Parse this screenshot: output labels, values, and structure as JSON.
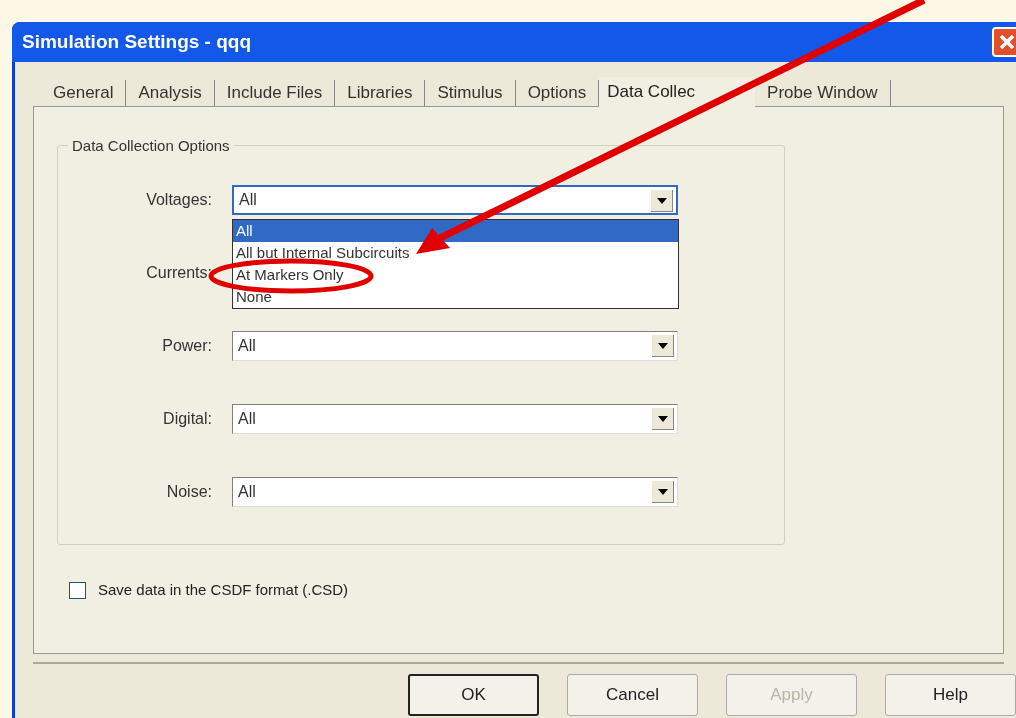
{
  "window": {
    "title": "Simulation Settings - qqq"
  },
  "tabs": [
    {
      "label": "General",
      "selected": false
    },
    {
      "label": "Analysis",
      "selected": false
    },
    {
      "label": "Include Files",
      "selected": false
    },
    {
      "label": "Libraries",
      "selected": false
    },
    {
      "label": "Stimulus",
      "selected": false
    },
    {
      "label": "Options",
      "selected": false
    },
    {
      "label": "Data Collec",
      "selected": true
    },
    {
      "label": "Probe Window",
      "selected": false
    }
  ],
  "group": {
    "title": "Data Collection Options",
    "fields": [
      {
        "label": "Voltages:",
        "value": "All",
        "expanded": true,
        "options": [
          {
            "label": "All",
            "selected": true
          },
          {
            "label": "All but Internal Subcircuits",
            "selected": false
          },
          {
            "label": "At Markers Only",
            "selected": false
          },
          {
            "label": "None",
            "selected": false
          }
        ]
      },
      {
        "label": "Currents:"
      },
      {
        "label": "Power:",
        "value": "All"
      },
      {
        "label": "Digital:",
        "value": "All"
      },
      {
        "label": "Noise:",
        "value": "All"
      }
    ]
  },
  "checkbox": {
    "label": "Save data in the CSDF format (.CSD)",
    "checked": false
  },
  "buttons": [
    {
      "label": "OK",
      "default": true,
      "disabled": false
    },
    {
      "label": "Cancel",
      "default": false,
      "disabled": false
    },
    {
      "label": "Apply",
      "default": false,
      "disabled": true
    },
    {
      "label": "Help",
      "default": false,
      "disabled": false
    }
  ]
}
